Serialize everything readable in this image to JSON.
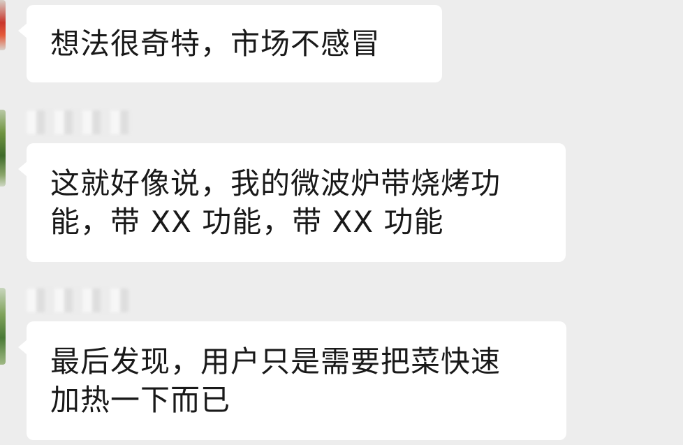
{
  "chat": {
    "messages": [
      {
        "text": "想法很奇特，市场不感冒"
      },
      {
        "text": "这就好像说，我的微波炉带烧烤功\n能，带 XX 功能，带 XX 功能"
      },
      {
        "text": "最后发现，用户只是需要把菜快速\n加热一下而已"
      }
    ]
  },
  "colors": {
    "background": "#ededed",
    "bubble": "#ffffff",
    "text": "#191919"
  }
}
